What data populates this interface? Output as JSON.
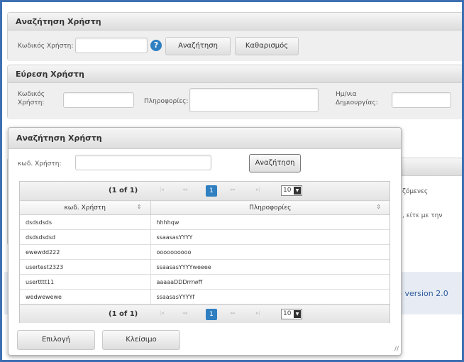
{
  "panel_search": {
    "title": "Αναζήτηση Χρήστη",
    "code_label": "Κωδικός Χρήστη:",
    "code_value": "",
    "help_icon": "?",
    "search_button": "Αναζήτηση",
    "clear_button": "Καθαρισμός"
  },
  "panel_find": {
    "title": "Εύρεση Χρήστη",
    "code_label_1": "Κωδικός",
    "code_label_2": "Χρήστη:",
    "info_label": "Πληροφορίες:",
    "date_label_1": "Ημ/νια",
    "date_label_2": "Δημιουργίας:"
  },
  "background": {
    "text_1": "ζόμενες",
    "text_2": ", είτε με την",
    "version": "- version 2.0"
  },
  "dialog": {
    "title": "Αναζήτηση Χρήστη",
    "code_label": "κωδ. Χρήστη:",
    "code_value": "",
    "search_button": "Αναζήτηση",
    "select_button": "Επιλογή",
    "close_button": "Κλείσιμο",
    "resize_icon": "//"
  },
  "paginator": {
    "page_info": "(1 of 1)",
    "first_icon": "|◂",
    "prev_icon": "◂◂",
    "current_page": "1",
    "next_icon": "▸▸",
    "last_icon": "▸|",
    "rows_per_page": "10"
  },
  "table": {
    "columns": [
      "κωδ. Χρήστη",
      "Πληροφορίες"
    ],
    "sort_icon": "⇕",
    "rows": [
      [
        "dsdsdsds",
        "hhhhqw"
      ],
      [
        "dsdsdsdsd",
        "ssaasasYYYY"
      ],
      [
        "ewewdd222",
        "oooooooooo"
      ],
      [
        "usertest2323",
        "ssaasasYYYYweeee"
      ],
      [
        "usertttt11",
        "aaaaaDDDrrrwff"
      ],
      [
        "wedwewewe",
        "ssaasasYYYYf"
      ]
    ]
  }
}
